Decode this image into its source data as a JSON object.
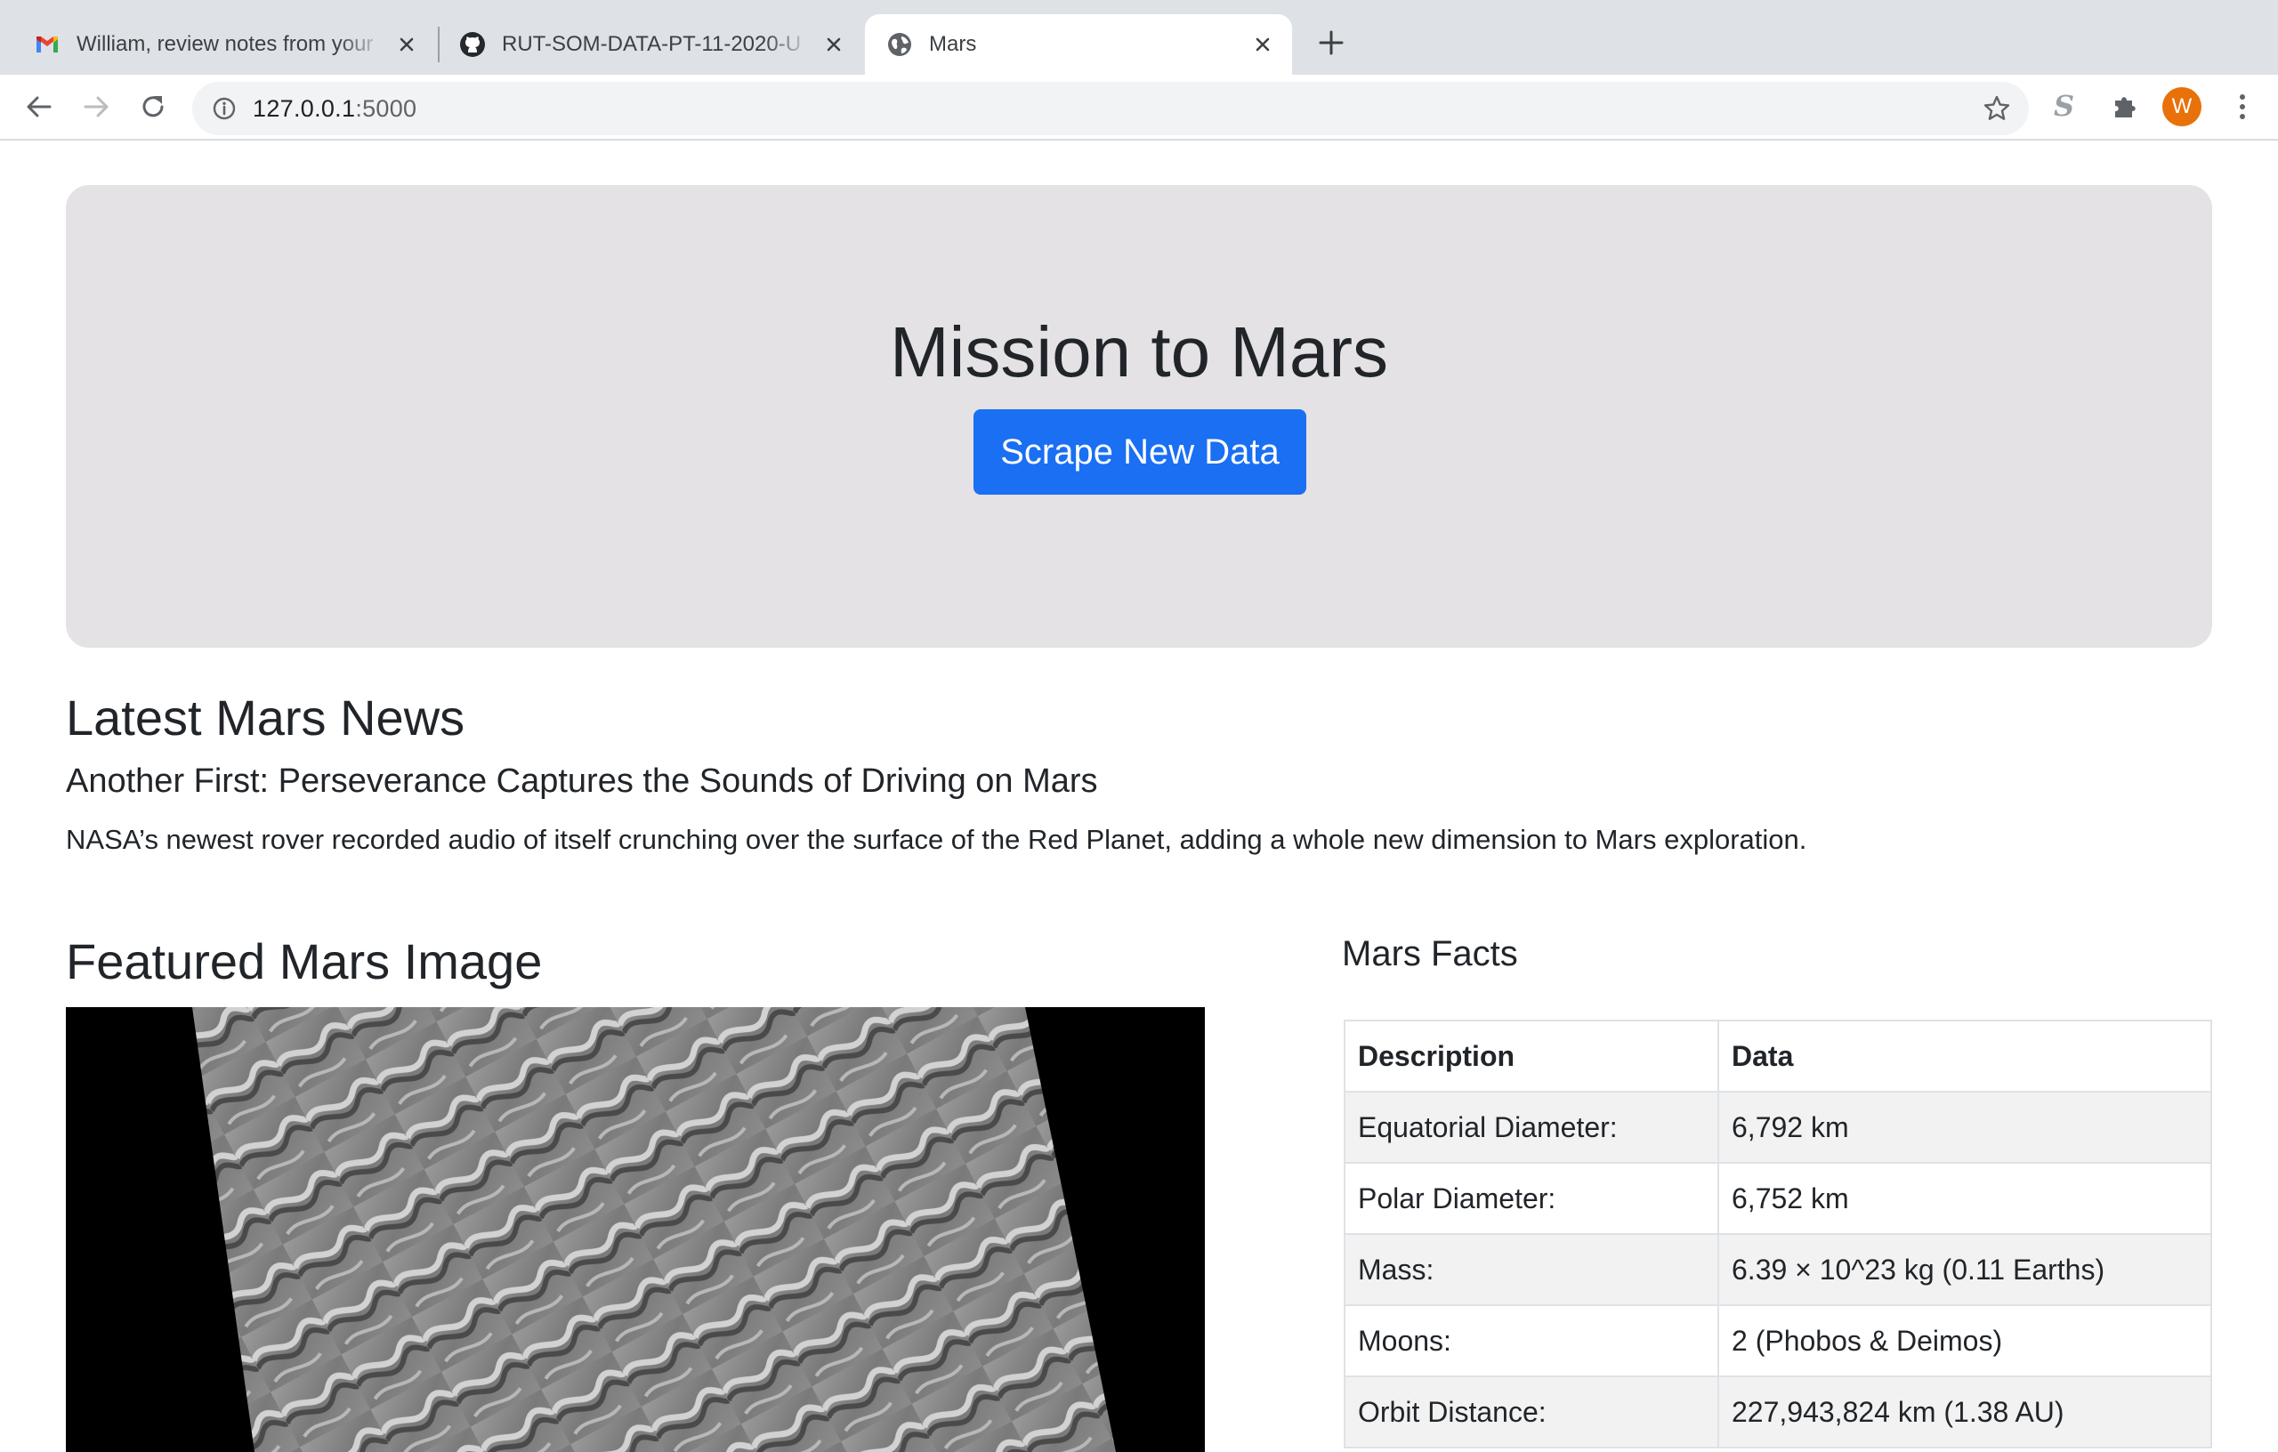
{
  "browser": {
    "tabs": [
      {
        "title": "William, review notes from your",
        "icon": "gmail-icon"
      },
      {
        "title": "RUT-SOM-DATA-PT-11-2020-U",
        "icon": "github-icon"
      },
      {
        "title": "Mars",
        "icon": "globe-icon",
        "active": true
      }
    ],
    "url_host": "127.0.0.1",
    "url_port": ":5000",
    "profile_initial": "W",
    "extension_label": "S",
    "colors": {
      "tabstrip": "#dee1e6",
      "avatar": "#e8710a",
      "accent": "#1a6ff2"
    }
  },
  "page": {
    "jumbotron": {
      "title": "Mission to Mars",
      "button_label": "Scrape New Data"
    },
    "news": {
      "heading": "Latest Mars News",
      "title": "Another First: Perseverance Captures the Sounds of Driving on Mars",
      "paragraph": "NASA’s newest rover recorded audio of itself crunching over the surface of the Red Planet, adding a whole new dimension to Mars exploration."
    },
    "featured": {
      "heading": "Featured Mars Image"
    },
    "facts": {
      "heading": "Mars Facts",
      "columns": [
        "Description",
        "Data"
      ],
      "rows": [
        [
          "Equatorial Diameter:",
          "6,792 km"
        ],
        [
          "Polar Diameter:",
          "6,752 km"
        ],
        [
          "Mass:",
          "6.39 × 10^23 kg (0.11 Earths)"
        ],
        [
          "Moons:",
          "2 (Phobos & Deimos)"
        ],
        [
          "Orbit Distance:",
          "227,943,824 km (1.38 AU)"
        ]
      ]
    }
  }
}
